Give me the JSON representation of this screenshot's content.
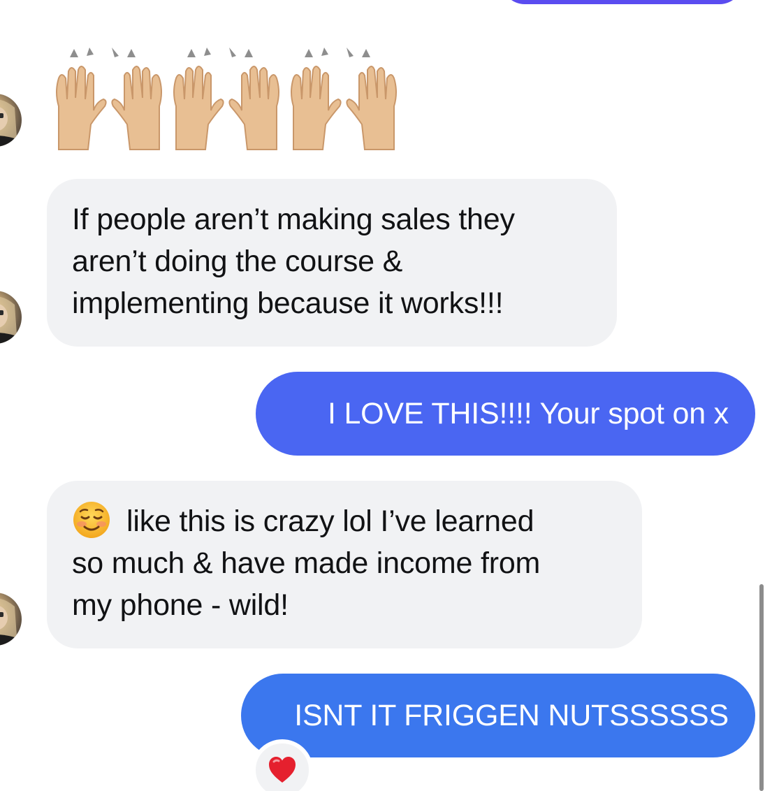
{
  "conversation": {
    "messages": [
      {
        "direction": "outgoing",
        "text": ""
      },
      {
        "direction": "incoming",
        "emoji": "raising-hands x3"
      },
      {
        "direction": "incoming",
        "lines": [
          "If people aren’t making sales they",
          "aren’t doing the course &",
          "implementing because it works!!!"
        ]
      },
      {
        "direction": "outgoing",
        "text": "I LOVE THIS!!!! Your spot on x"
      },
      {
        "direction": "incoming",
        "lines": [
          "like this is crazy lol I’ve learned",
          "so much & have made income from",
          "my phone - wild!"
        ]
      },
      {
        "direction": "outgoing",
        "text": "ISNT IT FRIGGEN NUTSSSSSS",
        "reaction": "❤️"
      }
    ]
  },
  "icons": {
    "reaction": "heart-icon",
    "emoji_smile": "smiling-face-icon",
    "emoji_hands": "raising-hands-icon",
    "avatar": "avatar"
  },
  "colors": {
    "incoming_bubble": "#f1f2f4",
    "outgoing_bubble_1": "#4a66f2",
    "outgoing_bubble_2": "#3b77ee",
    "top_bubble": "#5a4cf0",
    "text_dark": "#111214",
    "text_light": "#ffffff",
    "heart": "#e5202e"
  }
}
